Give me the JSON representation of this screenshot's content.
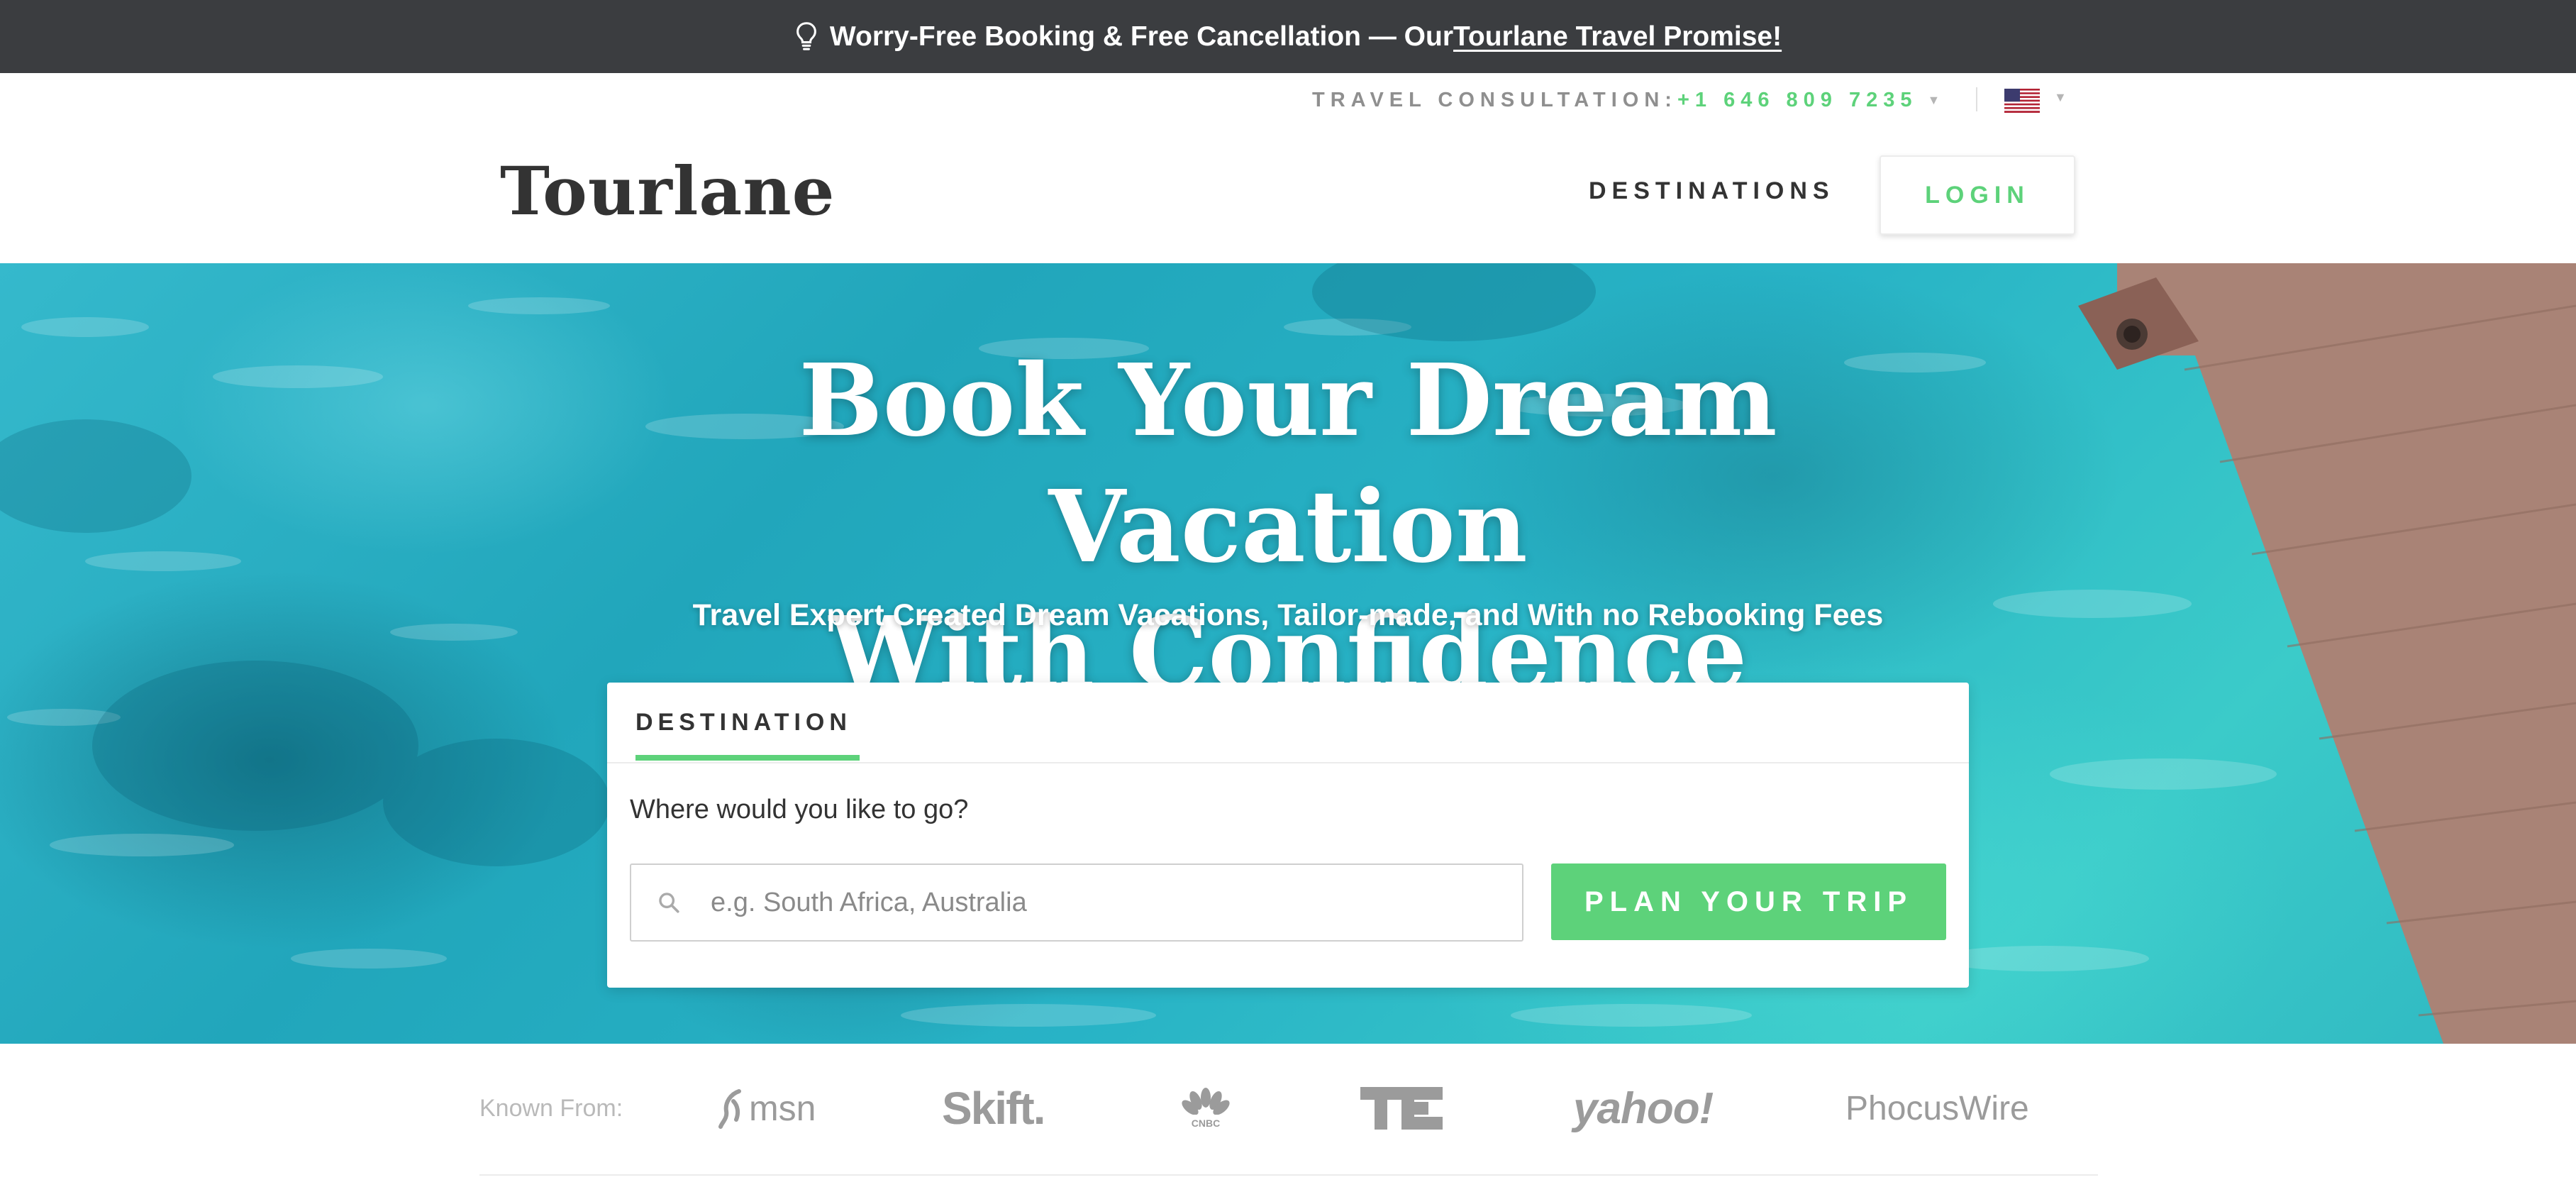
{
  "promo": {
    "icon": "lightbulb-icon",
    "text": "Worry-Free Booking & Free Cancellation — Our ",
    "link": "Tourlane Travel Promise!"
  },
  "utility": {
    "consult_label": "TRAVEL CONSULTATION: ",
    "phone": "+1 646 809 7235",
    "flag_icon": "us-flag-icon"
  },
  "header": {
    "logo": "Tourlane",
    "nav_destinations": "DESTINATIONS",
    "login": "LOGIN"
  },
  "hero": {
    "title_line1": "Book Your Dream Vacation",
    "title_line2": "With Confidence",
    "subtitle": "Travel Expert Created Dream Vacations, Tailor-made, and With no Rebooking Fees"
  },
  "search": {
    "tab": "DESTINATION",
    "question": "Where would you like to go?",
    "placeholder": "e.g. South Africa, Australia",
    "value": "",
    "button": "PLAN YOUR TRIP"
  },
  "press": {
    "label": "Known From:",
    "logos": [
      "msn",
      "Skift.",
      "CNBC",
      "TC",
      "yahoo!",
      "PhocusWire"
    ]
  },
  "colors": {
    "accent": "#5dd27a",
    "promo_bg": "#3b3d40",
    "text_dark": "#333333"
  }
}
